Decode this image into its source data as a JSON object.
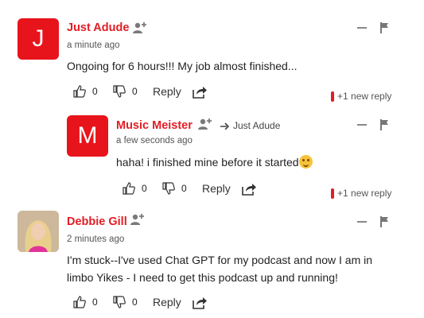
{
  "comments": [
    {
      "avatar_letter": "J",
      "author": "Just Adude",
      "time": "a minute ago",
      "text_lines": [
        "Ongoing for 6 hours!!! My job almost finished..."
      ],
      "likes": "0",
      "dislikes": "0",
      "reply_label": "Reply",
      "new_reply": "+1 new reply"
    },
    {
      "avatar_letter": "M",
      "author": "Music Meister",
      "reply_to": "Just Adude",
      "time": "a few seconds ago",
      "text_lines": [
        "haha! i finished mine before it started"
      ],
      "likes": "0",
      "dislikes": "0",
      "reply_label": "Reply",
      "new_reply": "+1 new reply"
    },
    {
      "author": "Debbie Gill",
      "time": "2 minutes ago",
      "text_lines": [
        "I'm stuck--I've used Chat GPT for my podcast and now I am in",
        "limbo Yikes - I need to get this podcast up and running!"
      ],
      "likes": "0",
      "dislikes": "0",
      "reply_label": "Reply"
    }
  ],
  "icons": {
    "add_user": "add-user-icon",
    "thumbs_up": "thumbs-up-icon",
    "thumbs_down": "thumbs-down-icon",
    "share": "share-icon",
    "collapse": "minus-icon",
    "flag": "flag-icon",
    "reply_arrow": "reply-arrow-icon",
    "emoji": "smiley-emoji-icon"
  },
  "colors": {
    "accent": "#e11d26",
    "avatar_bg": "#e8141c"
  }
}
